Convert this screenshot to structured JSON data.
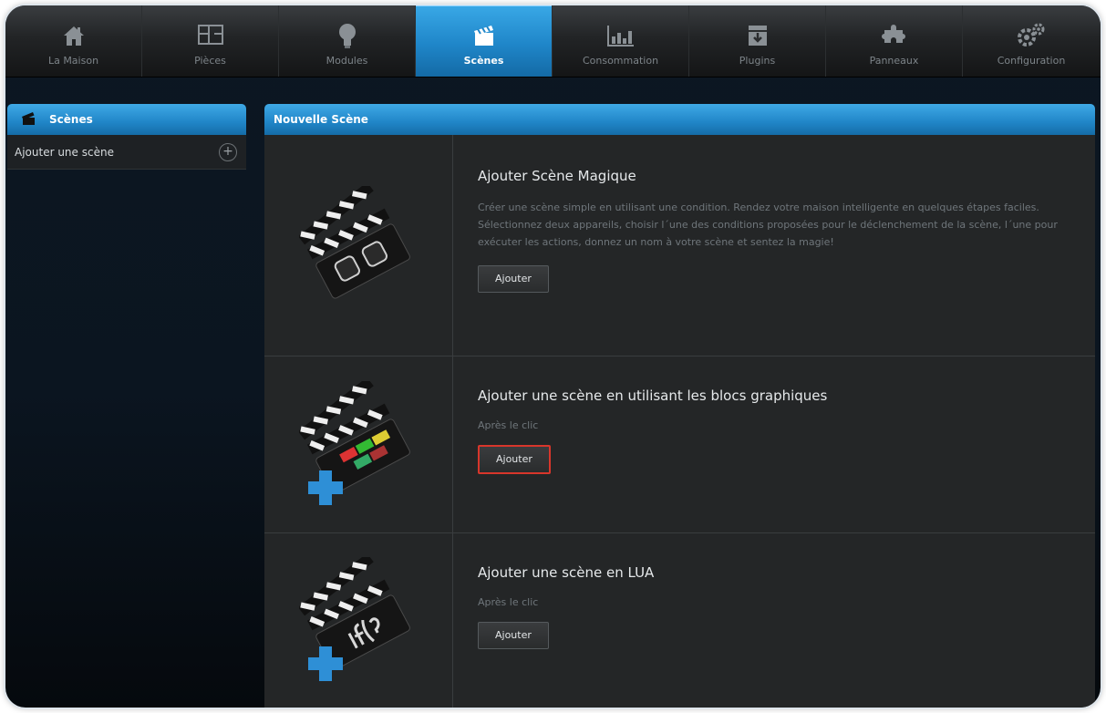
{
  "nav": {
    "tabs": [
      {
        "label": "La Maison",
        "icon": "house-icon"
      },
      {
        "label": "Pièces",
        "icon": "rooms-icon"
      },
      {
        "label": "Modules",
        "icon": "bulb-icon"
      },
      {
        "label": "Scènes",
        "icon": "clapperboard-icon",
        "active": true
      },
      {
        "label": "Consommation",
        "icon": "chart-icon"
      },
      {
        "label": "Plugins",
        "icon": "download-box-icon"
      },
      {
        "label": "Panneaux",
        "icon": "puzzle-icon"
      },
      {
        "label": "Configuration",
        "icon": "gears-icon"
      }
    ]
  },
  "sidebar": {
    "title": "Scènes",
    "items": [
      {
        "label": "Ajouter une scène"
      }
    ]
  },
  "main": {
    "title": "Nouvelle Scène",
    "rows": [
      {
        "title": "Ajouter Scène Magique",
        "description": "Créer une scène simple en utilisant une condition. Rendez votre maison intelligente en quelques étapes faciles. Sélectionnez deux appareils, choisir l´une des conditions proposées pour le déclenchement de la scène, l´une pour exécuter les actions, donnez un nom à votre scène et sentez la magie!",
        "button": "Ajouter",
        "image": "magic-scene-icon"
      },
      {
        "title": "Ajouter une scène en utilisant les blocs graphiques",
        "description": "Après le clic",
        "button": "Ajouter",
        "image": "graphic-blocks-scene-icon"
      },
      {
        "title": "Ajouter une scène en LUA",
        "description": "Après le clic",
        "button": "Ajouter",
        "image": "lua-scene-icon"
      }
    ]
  },
  "colors": {
    "accent": "#2a8fd3",
    "highlight": "#d8362b"
  }
}
